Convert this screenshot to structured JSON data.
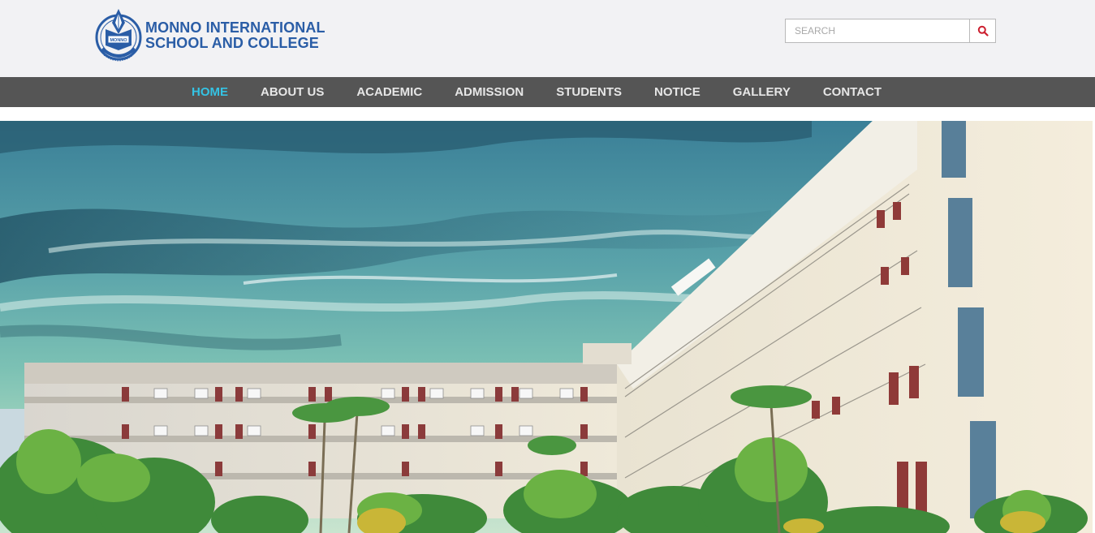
{
  "brand": {
    "line1": "MONNO INTERNATIONAL",
    "line2": "SCHOOL AND COLLEGE",
    "emblem_text": "MONNO",
    "color": "#2a5da6"
  },
  "search": {
    "placeholder": "SEARCH",
    "icon": "search-icon",
    "icon_color": "#cc1f2f"
  },
  "nav": {
    "background": "#555555",
    "active_color": "#34c3e4",
    "items": [
      {
        "label": "HOME",
        "active": true
      },
      {
        "label": "ABOUT US",
        "active": false
      },
      {
        "label": "ACADEMIC",
        "active": false
      },
      {
        "label": "ADMISSION",
        "active": false
      },
      {
        "label": "STUDENTS",
        "active": false
      },
      {
        "label": "NOTICE",
        "active": false
      },
      {
        "label": "GALLERY",
        "active": false
      },
      {
        "label": "CONTACT",
        "active": false
      }
    ]
  },
  "hero": {
    "image": "campus-building-photo"
  }
}
